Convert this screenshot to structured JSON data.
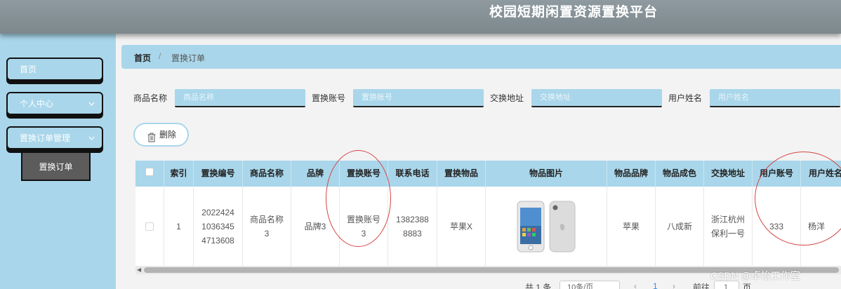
{
  "header": {
    "title": "校园短期闲置资源置换平台"
  },
  "sidebar": {
    "items": [
      {
        "label": "首页",
        "chevron": ""
      },
      {
        "label": "个人中心",
        "chevron": "⌄"
      },
      {
        "label": "置换订单管理",
        "chevron": "⌄"
      }
    ],
    "sub_item": "置换订单"
  },
  "breadcrumb": {
    "home": "首页",
    "separator": "/",
    "current": "置换订单"
  },
  "search": {
    "fields": [
      {
        "label": "商品名称",
        "placeholder": "商品名称"
      },
      {
        "label": "置换账号",
        "placeholder": "置换账号"
      },
      {
        "label": "交换地址",
        "placeholder": "交换地址"
      },
      {
        "label": "用户姓名",
        "placeholder": "用户姓名"
      }
    ]
  },
  "actions": {
    "delete_label": "删除"
  },
  "table": {
    "columns": [
      "",
      "索引",
      "置换编号",
      "商品名称",
      "品牌",
      "置换账号",
      "联系电话",
      "置换物品",
      "物品图片",
      "物品品牌",
      "物品成色",
      "交换地址",
      "用户账号",
      "用户姓名"
    ],
    "rows": [
      {
        "index": "1",
        "order_no": "20224241036345 4713608",
        "order_no_lines": [
          "2022424",
          "1036345",
          "4713608"
        ],
        "product_name_lines": [
          "商品名称",
          "3"
        ],
        "brand": "品牌3",
        "swap_account_lines": [
          "置换账号",
          "3"
        ],
        "phone_lines": [
          "1382388",
          "8883"
        ],
        "swap_item": "苹果X",
        "item_image": "phone-image",
        "item_brand": "苹果",
        "condition": "八成新",
        "address_lines": [
          "浙江杭州",
          "保利一号"
        ],
        "user_account": "333",
        "user_name": "杨洋"
      }
    ]
  },
  "pagination": {
    "total_text": "共 1 条",
    "page_size": "10条/页",
    "page": "1",
    "goto_label": "前往",
    "goto_value": "1",
    "page_suffix": "页"
  },
  "watermark": "CSDN @卓怡工作室",
  "colors": {
    "accent": "#a9d6ea",
    "topbar": "#858f94",
    "annotation": "#d64545"
  }
}
